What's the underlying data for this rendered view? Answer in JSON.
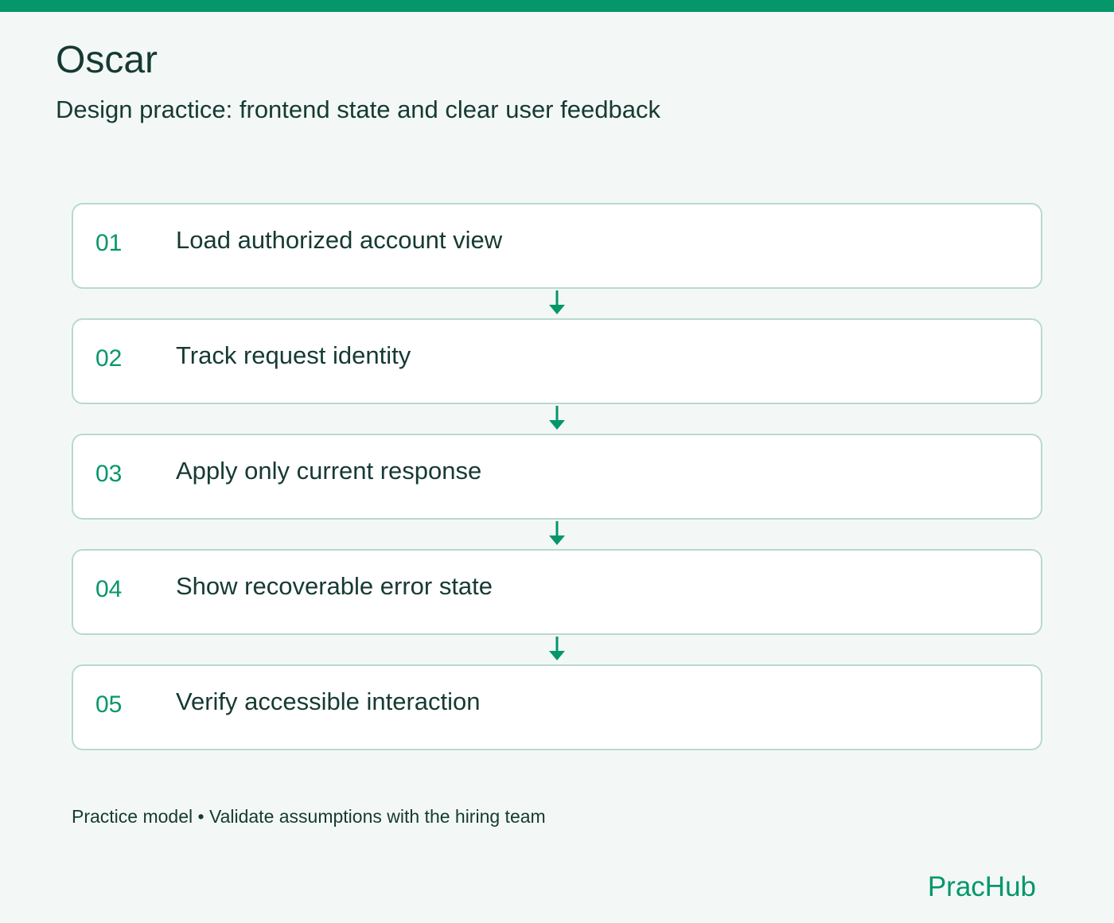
{
  "header": {
    "title": "Oscar",
    "subtitle": "Design practice: frontend state and clear user feedback"
  },
  "steps": [
    {
      "number": "01",
      "label": "Load authorized account view"
    },
    {
      "number": "02",
      "label": "Track request identity"
    },
    {
      "number": "03",
      "label": "Apply only current response"
    },
    {
      "number": "04",
      "label": "Show recoverable error state"
    },
    {
      "number": "05",
      "label": "Verify accessible interaction"
    }
  ],
  "connector_icon": "arrow-down-icon",
  "footer": {
    "note": "Practice model • Validate assumptions with the hiring team",
    "brand": "PracHub"
  },
  "colors": {
    "accent": "#05966a",
    "text": "#163a33",
    "card_border": "#b9d9cf",
    "card_bg": "#ffffff",
    "page_bg": "#f3f8f6"
  }
}
